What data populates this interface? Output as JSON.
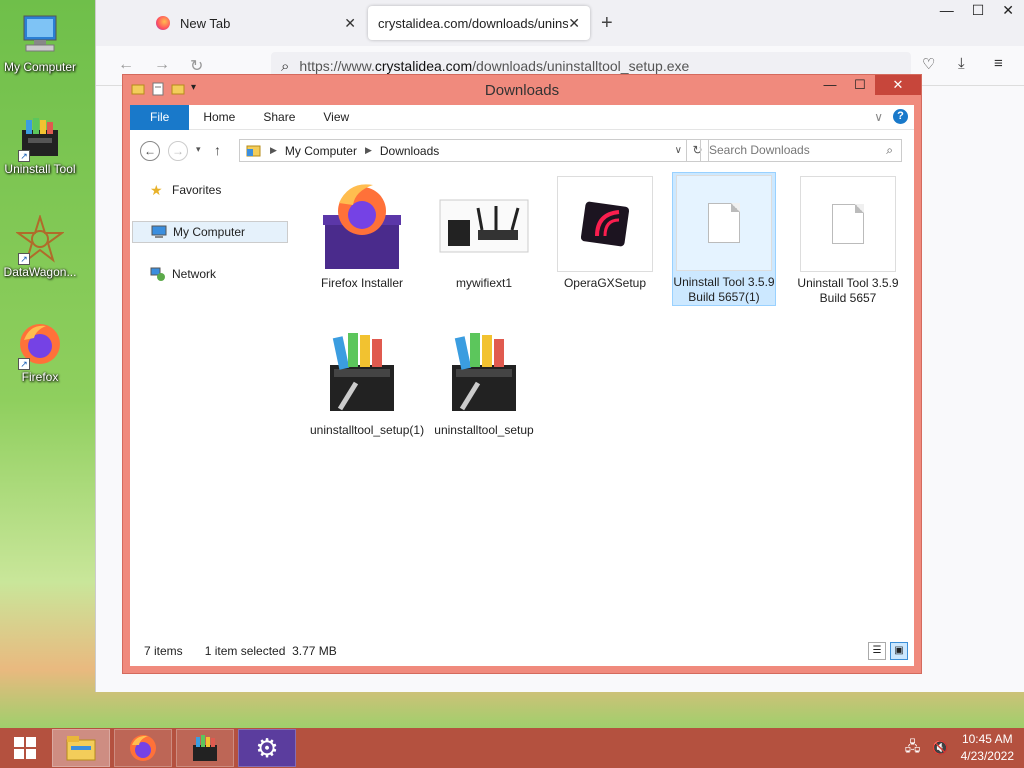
{
  "desktop": {
    "icons": [
      {
        "label": "My Computer"
      },
      {
        "label": "Uninstall Tool"
      },
      {
        "label": "DataWagon..."
      },
      {
        "label": "Firefox"
      }
    ]
  },
  "browser": {
    "tabs": [
      {
        "label": "New Tab"
      },
      {
        "label": "crystalidea.com/downloads/uninsta"
      }
    ],
    "url_prefix": "https://www.",
    "url_domain": "crystalidea.com",
    "url_path": "/downloads/uninstalltool_setup.exe"
  },
  "explorer": {
    "title": "Downloads",
    "ribbon_tabs": [
      "File",
      "Home",
      "Share",
      "View"
    ],
    "breadcrumb": [
      "My Computer",
      "Downloads"
    ],
    "search_placeholder": "Search Downloads",
    "nav": [
      "Favorites",
      "My Computer",
      "Network"
    ],
    "files": [
      {
        "name": "Firefox Installer",
        "icon": "firefox-installer-icon"
      },
      {
        "name": "mywifiext1",
        "icon": "router-thumbnail"
      },
      {
        "name": "OperaGXSetup",
        "icon": "opera-gx-icon"
      },
      {
        "name": "Uninstall Tool 3.5.9 Build 5657(1)",
        "icon": "blank-file-icon",
        "selected": true
      },
      {
        "name": "Uninstall Tool 3.5.9 Build 5657",
        "icon": "blank-file-icon"
      },
      {
        "name": "uninstalltool_setup(1)",
        "icon": "uninstall-tool-icon"
      },
      {
        "name": "uninstalltool_setup",
        "icon": "uninstall-tool-icon"
      }
    ],
    "status_items": "7 items",
    "status_selected": "1 item selected  3.77 MB"
  },
  "taskbar": {
    "time": "10:45 AM",
    "date": "4/23/2022"
  },
  "colors": {
    "window_frame": "#f08a7d",
    "taskbar": "#b4513f",
    "file_tab": "#1979ca"
  }
}
